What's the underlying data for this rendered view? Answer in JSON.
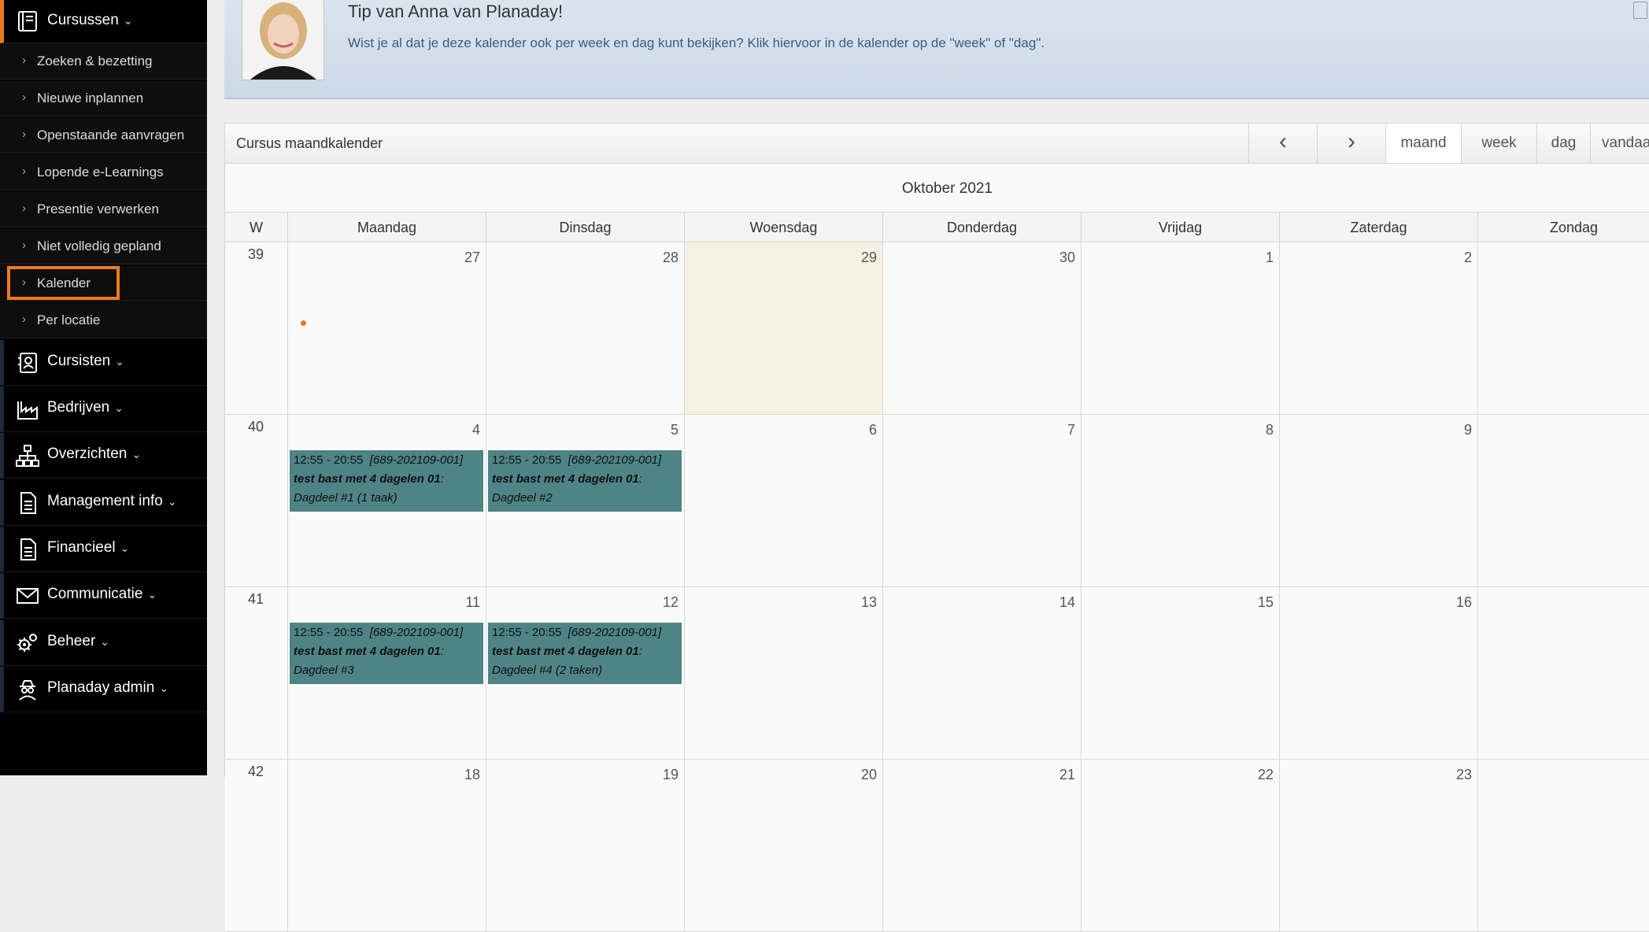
{
  "sidebar": {
    "courses": {
      "label": "Cursussen",
      "chev": "⌄"
    },
    "subitems": [
      {
        "label": "Zoeken & bezetting"
      },
      {
        "label": "Nieuwe inplannen"
      },
      {
        "label": "Openstaande aanvragen"
      },
      {
        "label": "Lopende e-Learnings"
      },
      {
        "label": "Presentie verwerken"
      },
      {
        "label": "Niet volledig gepland"
      },
      {
        "label": "Kalender"
      },
      {
        "label": "Per locatie"
      }
    ],
    "sections": [
      {
        "label": "Cursisten",
        "icon": "contact-book-icon"
      },
      {
        "label": "Bedrijven",
        "icon": "factory-icon"
      },
      {
        "label": "Overzichten",
        "icon": "sitemap-icon"
      },
      {
        "label": "Management info",
        "icon": "document-icon"
      },
      {
        "label": "Financieel",
        "icon": "document-icon"
      },
      {
        "label": "Communicatie",
        "icon": "envelope-icon"
      },
      {
        "label": "Beheer",
        "icon": "gears-icon"
      },
      {
        "label": "Planaday admin",
        "icon": "spy-icon"
      }
    ],
    "caret": "›",
    "chevron": "⌄",
    "accent": "#e87722"
  },
  "tip": {
    "title": "Tip van Anna van Planaday!",
    "text": "Wist je al dat je deze kalender ook per week en dag kunt bekijken? Klik hiervoor in de kalender op de \"week\" of \"dag\"."
  },
  "calendar": {
    "title": "Cursus maandkalender",
    "prev": "‹",
    "next": "›",
    "views": [
      "maand",
      "week",
      "dag",
      "vandaag"
    ],
    "active_view": "maand",
    "month": "Oktober 2021",
    "week_header": "W",
    "days": [
      "Maandag",
      "Dinsdag",
      "Woensdag",
      "Donderdag",
      "Vrijdag",
      "Zaterdag",
      "Zondag"
    ],
    "weeks": [
      {
        "num": "39",
        "dates": [
          "27",
          "28",
          "29",
          "30",
          "1",
          "2",
          ""
        ]
      },
      {
        "num": "40",
        "dates": [
          "4",
          "5",
          "6",
          "7",
          "8",
          "9",
          ""
        ]
      },
      {
        "num": "41",
        "dates": [
          "11",
          "12",
          "13",
          "14",
          "15",
          "16",
          ""
        ]
      },
      {
        "num": "42",
        "dates": [
          "18",
          "19",
          "20",
          "21",
          "22",
          "23",
          ""
        ]
      }
    ],
    "today": "29",
    "events": [
      {
        "week": 1,
        "day": 0,
        "time": "12:55 - 20:55",
        "code": "[689-202109-001]",
        "name": "test bast met 4 dagelen 01",
        "part": "Dagdeel #1 (1 taak)"
      },
      {
        "week": 1,
        "day": 1,
        "time": "12:55 - 20:55",
        "code": "[689-202109-001]",
        "name": "test bast met 4 dagelen 01",
        "part": "Dagdeel #2"
      },
      {
        "week": 2,
        "day": 0,
        "time": "12:55 - 20:55",
        "code": "[689-202109-001]",
        "name": "test bast met 4 dagelen 01",
        "part": "Dagdeel #3"
      },
      {
        "week": 2,
        "day": 1,
        "time": "12:55 - 20:55",
        "code": "[689-202109-001]",
        "name": "test bast met 4 dagelen 01",
        "part": "Dagdeel #4 (2 taken)"
      }
    ],
    "event_color": "#4e8485",
    "today_color": "#f4f1e2"
  }
}
